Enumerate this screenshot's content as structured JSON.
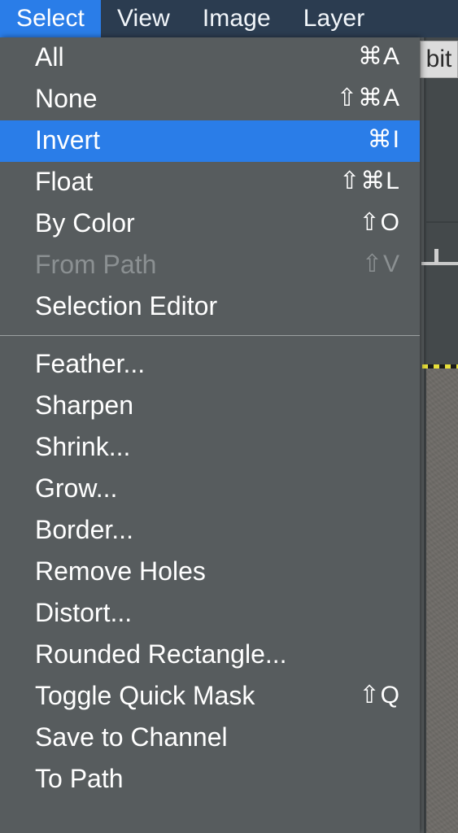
{
  "menubar": {
    "items": [
      {
        "label": "Select",
        "active": true
      },
      {
        "label": "View",
        "active": false
      },
      {
        "label": "Image",
        "active": false
      },
      {
        "label": "Layer",
        "active": false
      }
    ]
  },
  "canvas": {
    "depth_badge": "bit"
  },
  "colors": {
    "menubar_bg": "#2b3c50",
    "accent_blue": "#2a7de8",
    "menu_bg": "#575c5e",
    "menu_text": "#ffffff",
    "menu_text_disabled": "#8b9092",
    "separator": "#9ba0a1",
    "selection_ants_yellow": "#e8e03a",
    "canvas_bg": "#4b5052"
  },
  "menu": {
    "title": "Select",
    "groups": [
      {
        "items": [
          {
            "label": "All",
            "shortcut": "⌘A",
            "selected": false,
            "disabled": false
          },
          {
            "label": "None",
            "shortcut": "⇧⌘A",
            "selected": false,
            "disabled": false
          },
          {
            "label": "Invert",
            "shortcut": "⌘I",
            "selected": true,
            "disabled": false
          },
          {
            "label": "Float",
            "shortcut": "⇧⌘L",
            "selected": false,
            "disabled": false
          },
          {
            "label": "By Color",
            "shortcut": "⇧O",
            "selected": false,
            "disabled": false
          },
          {
            "label": "From Path",
            "shortcut": "⇧V",
            "selected": false,
            "disabled": true
          },
          {
            "label": "Selection Editor",
            "shortcut": "",
            "selected": false,
            "disabled": false
          }
        ]
      },
      {
        "items": [
          {
            "label": "Feather...",
            "shortcut": "",
            "selected": false,
            "disabled": false
          },
          {
            "label": "Sharpen",
            "shortcut": "",
            "selected": false,
            "disabled": false
          },
          {
            "label": "Shrink...",
            "shortcut": "",
            "selected": false,
            "disabled": false
          },
          {
            "label": "Grow...",
            "shortcut": "",
            "selected": false,
            "disabled": false
          },
          {
            "label": "Border...",
            "shortcut": "",
            "selected": false,
            "disabled": false
          },
          {
            "label": "Remove Holes",
            "shortcut": "",
            "selected": false,
            "disabled": false
          },
          {
            "label": "Distort...",
            "shortcut": "",
            "selected": false,
            "disabled": false
          },
          {
            "label": "Rounded Rectangle...",
            "shortcut": "",
            "selected": false,
            "disabled": false
          },
          {
            "label": "Toggle Quick Mask",
            "shortcut": "⇧Q",
            "selected": false,
            "disabled": false
          },
          {
            "label": "Save to Channel",
            "shortcut": "",
            "selected": false,
            "disabled": false
          },
          {
            "label": "To Path",
            "shortcut": "",
            "selected": false,
            "disabled": false
          }
        ]
      }
    ]
  }
}
